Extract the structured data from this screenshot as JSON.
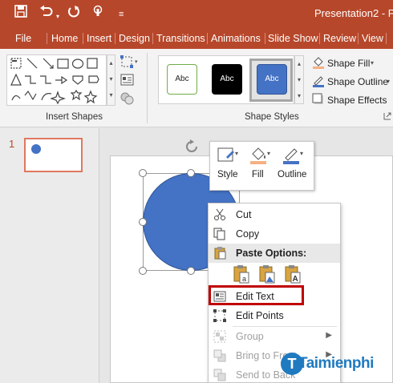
{
  "titlebar": {
    "title": "Presentation2 - P",
    "icons": [
      "save-icon",
      "undo-icon",
      "redo-icon",
      "touch-mode-icon",
      "customize-toolbar-icon"
    ]
  },
  "menu": [
    "File",
    "Home",
    "Insert",
    "Design",
    "Transitions",
    "Animations",
    "Slide Show",
    "Review",
    "View"
  ],
  "ribbon": {
    "insert_shapes_label": "Insert Shapes",
    "shape_styles_label": "Shape Styles",
    "style_swatches": [
      {
        "text": "Abc",
        "fill": "#ffffff",
        "border": "#70ad47",
        "color": "#222222"
      },
      {
        "text": "Abc",
        "fill": "#000000",
        "border": "#000000",
        "color": "#ffffff"
      },
      {
        "text": "Abc",
        "fill": "#4472c4",
        "border": "#2f5597",
        "color": "#ffffff"
      }
    ],
    "shape_fill": "Shape Fill",
    "shape_outline": "Shape Outline",
    "shape_effects": "Shape Effects"
  },
  "thumbnails": [
    {
      "number": "1"
    }
  ],
  "mini_toolbar": {
    "style": "Style",
    "fill": "Fill",
    "outline": "Outline"
  },
  "context_menu": {
    "cut": "Cut",
    "copy": "Copy",
    "paste_options": "Paste Options:",
    "edit_text": "Edit Text",
    "edit_points": "Edit Points",
    "group": "Group",
    "bring_to_front": "Bring to Front",
    "send_to_back": "Send to Back"
  },
  "watermark": "Taimienphi",
  "colors": {
    "accent": "#b7472a",
    "shape_blue": "#4472c4",
    "highlight": "#c00000"
  }
}
